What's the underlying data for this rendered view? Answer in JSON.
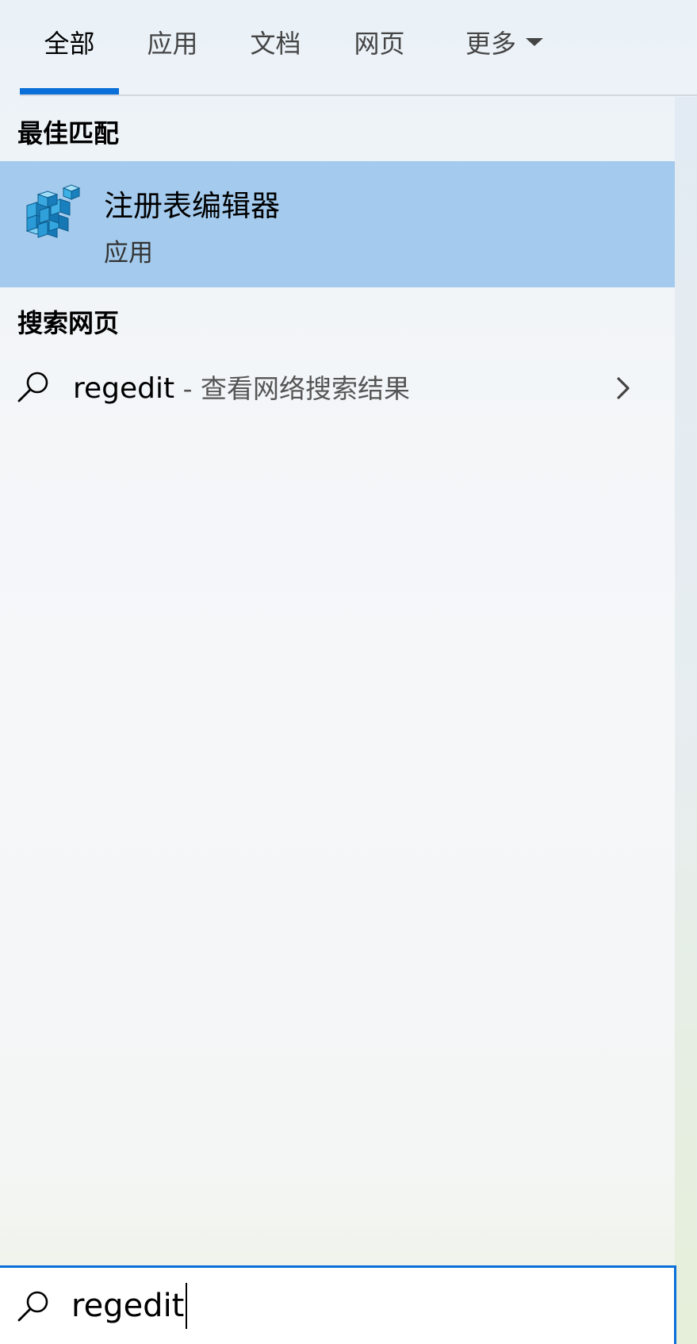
{
  "tabs": [
    {
      "label": "全部",
      "active": true
    },
    {
      "label": "应用",
      "active": false
    },
    {
      "label": "文档",
      "active": false
    },
    {
      "label": "网页",
      "active": false
    },
    {
      "label": "更多",
      "active": false
    }
  ],
  "best_match": {
    "heading": "最佳匹配",
    "app_name": "注册表编辑器",
    "app_type": "应用",
    "icon": "registry-editor-icon"
  },
  "web_search": {
    "heading": "搜索网页",
    "query": "regedit",
    "suffix": " - 查看网络搜索结果",
    "icon": "search-icon"
  },
  "search_box": {
    "value": "regedit",
    "icon": "search-icon"
  },
  "colors": {
    "accent": "#0a6fd8",
    "selected_row": "#a4cbed"
  }
}
